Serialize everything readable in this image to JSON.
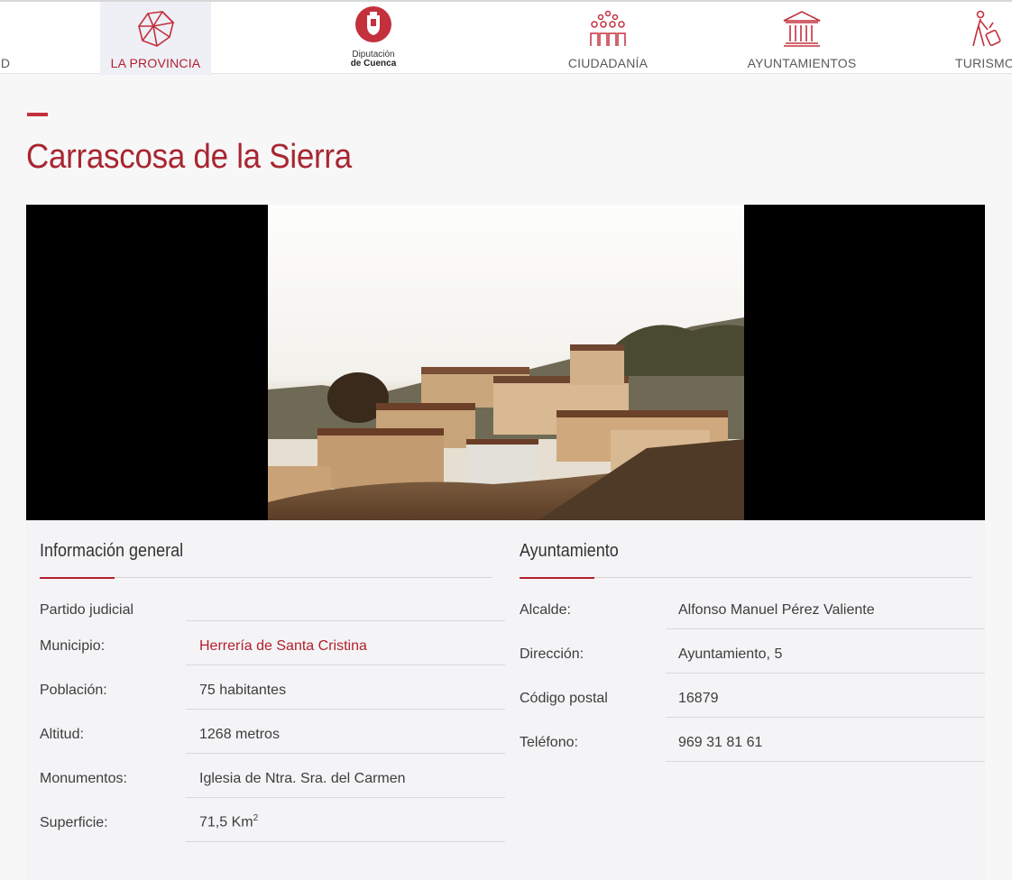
{
  "nav": {
    "partial_left": "D",
    "provincia": "LA PROVINCIA",
    "logo_line1": "Diputación",
    "logo_line2": "de Cuenca",
    "ciudadania": "CIUDADANÍA",
    "ayuntamientos": "AYUNTAMIENTOS",
    "turismo": "TURISMO"
  },
  "page": {
    "title": "Carrascosa de la Sierra"
  },
  "info": {
    "title": "Información general",
    "rows": [
      {
        "label": "Partido judicial",
        "value": ""
      },
      {
        "label": "Municipio:",
        "value": "Herrería de Santa Cristina"
      },
      {
        "label": "Población:",
        "value": "75 habitantes"
      },
      {
        "label": "Altitud:",
        "value": "1268 metros"
      },
      {
        "label": "Monumentos:",
        "value": "Iglesia de Ntra. Sra. del Carmen"
      },
      {
        "label": "Superficie:",
        "value": "71,5 Km",
        "sup": "2"
      }
    ]
  },
  "ayuntamiento": {
    "title": "Ayuntamiento",
    "rows": [
      {
        "label": "Alcalde:",
        "value": "Alfonso Manuel Pérez Valiente"
      },
      {
        "label": "Dirección:",
        "value": "Ayuntamiento, 5"
      },
      {
        "label": "Código postal",
        "value": "16879"
      },
      {
        "label": "Teléfono:",
        "value": "969 31 81 61"
      }
    ]
  },
  "colors": {
    "accent": "#b21f2d",
    "title": "#a82630"
  }
}
